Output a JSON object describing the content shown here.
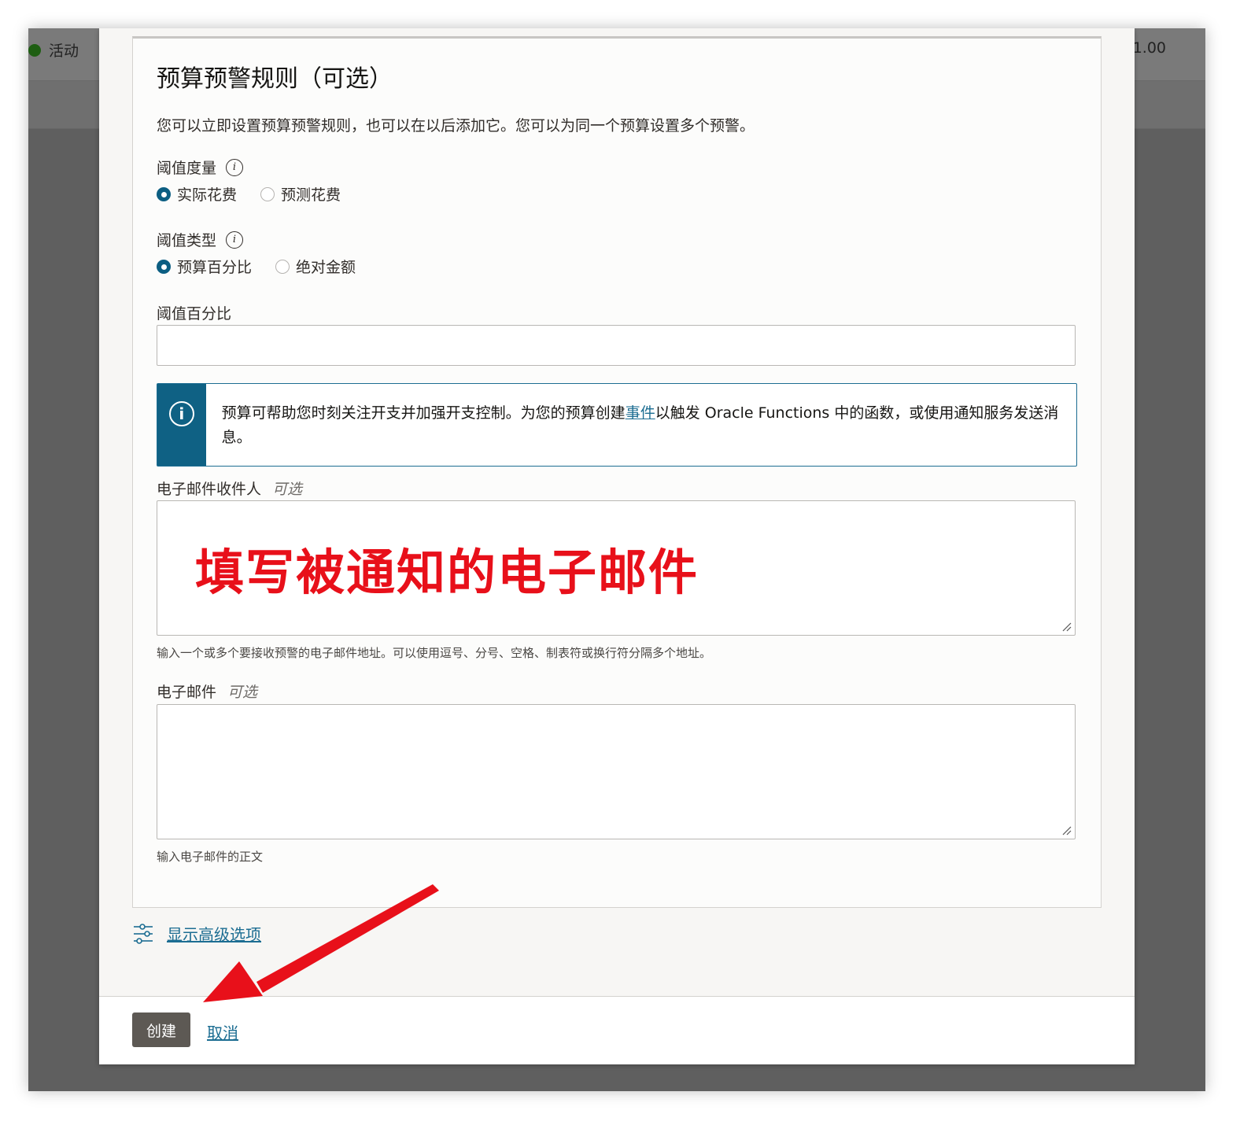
{
  "background": {
    "status_label": "活动",
    "amount_text": "1.00"
  },
  "section": {
    "title": "预算预警规则（可选）",
    "intro": "您可以立即设置预算预警规则，也可以在以后添加它。您可以为同一个预算设置多个预警。"
  },
  "threshold_metric": {
    "label": "阈值度量",
    "options": [
      {
        "label": "实际花费",
        "selected": true
      },
      {
        "label": "预测花费",
        "selected": false
      }
    ]
  },
  "threshold_type": {
    "label": "阈值类型",
    "options": [
      {
        "label": "预算百分比",
        "selected": true
      },
      {
        "label": "绝对金额",
        "selected": false
      }
    ]
  },
  "threshold_percent": {
    "label": "阈值百分比",
    "value": ""
  },
  "info_box": {
    "text_before": "预算可帮助您时刻关注开支并加强开支控制。为您的预算创建",
    "link": "事件",
    "text_after": "以触发 Oracle Functions 中的函数，或使用通知服务发送消息。"
  },
  "email_recipients": {
    "label": "电子邮件收件人",
    "optional": "可选",
    "annotation": "填写被通知的电子邮件",
    "help": "输入一个或多个要接收预警的电子邮件地址。可以使用逗号、分号、空格、制表符或换行符分隔多个地址。"
  },
  "email_body": {
    "label": "电子邮件",
    "optional": "可选",
    "help": "输入电子邮件的正文"
  },
  "advanced": {
    "label": "显示高级选项",
    "icon": "sliders-icon"
  },
  "footer": {
    "create_label": "创建",
    "cancel_label": "取消"
  },
  "colors": {
    "accent": "#0f6184",
    "annotation": "#e8101a",
    "create_button": "#5d5954"
  }
}
